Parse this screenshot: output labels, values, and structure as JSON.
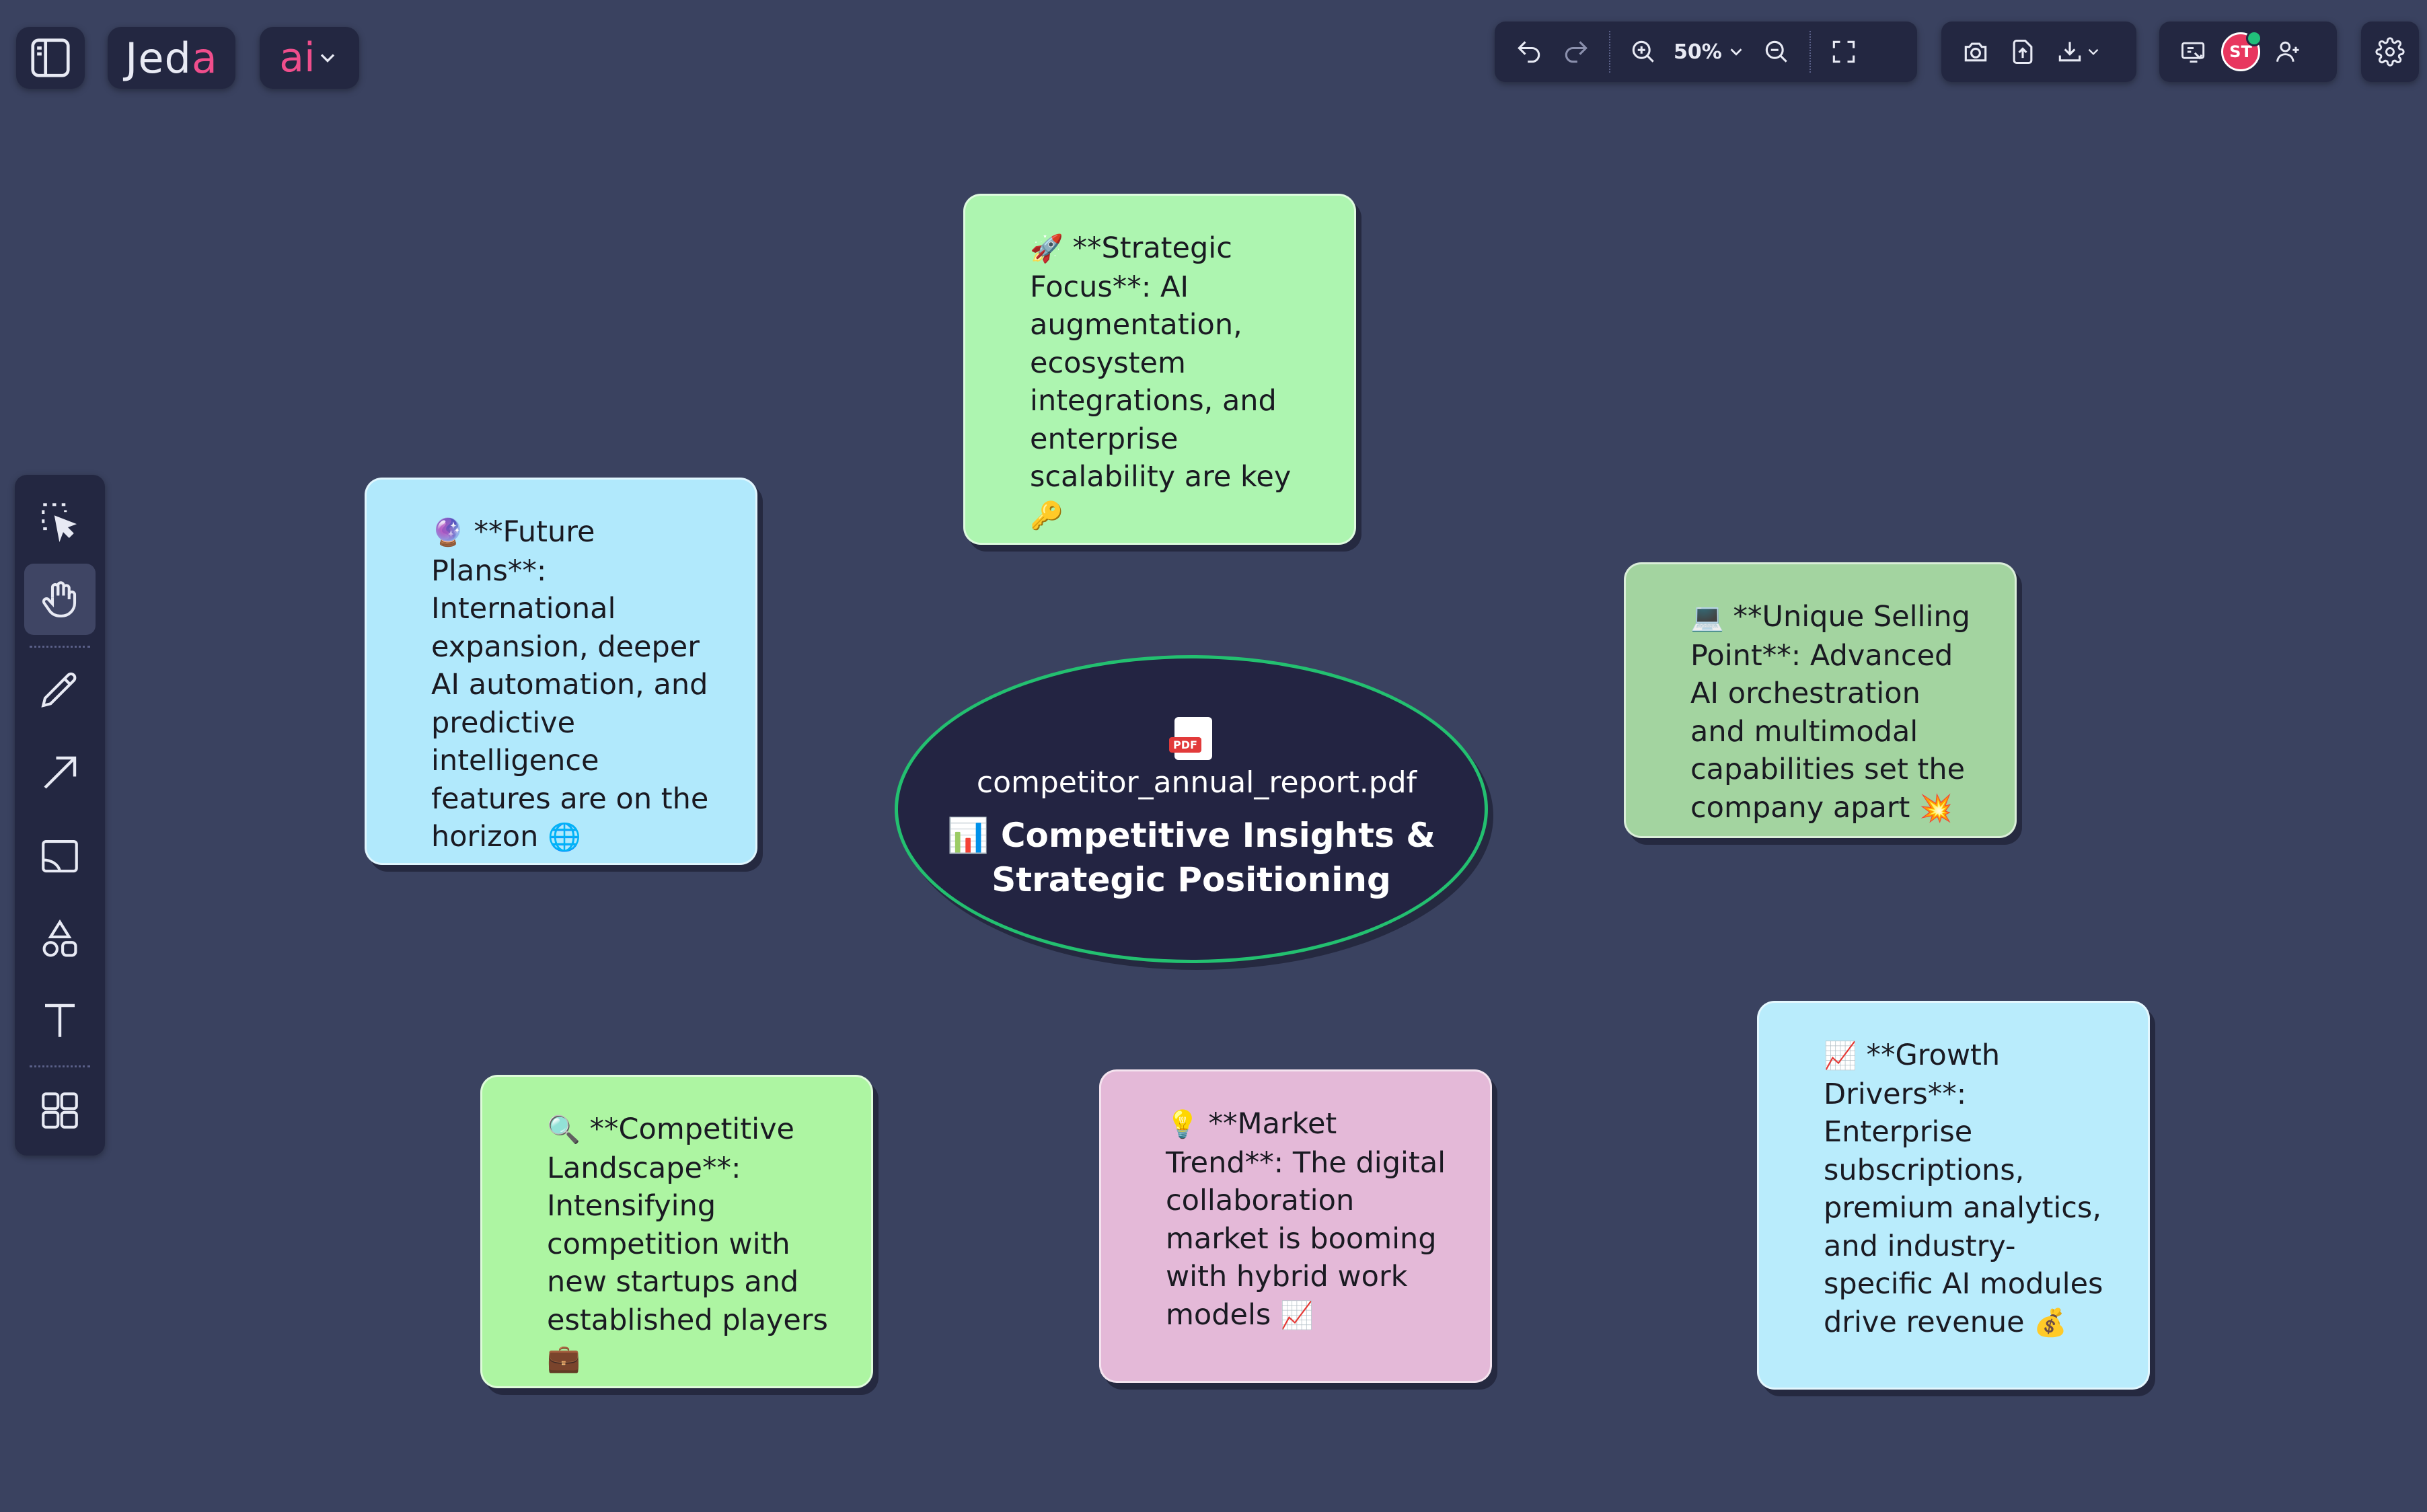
{
  "brand": {
    "logo_main": "Jed",
    "logo_accent": "a",
    "ai_label": "ai"
  },
  "toolbar": {
    "zoom": "50%",
    "user_initials": "ST"
  },
  "mindmap": {
    "center": {
      "file": "competitor_annual_report.pdf",
      "pdf_badge": "PDF",
      "title_emoji": "📊",
      "title_line1": "Competitive Insights &",
      "title_line2": "Strategic Positioning"
    },
    "cards": [
      {
        "emoji_start": "🚀",
        "text": " **Strategic Focus**: AI augmentation, ecosystem integrations, and enterprise scalability are key ",
        "emoji_end": "🔑",
        "color": "#adf5b0"
      },
      {
        "emoji_start": "🔮",
        "text": " **Future Plans**: International expansion, deeper AI automation, and predictive intelligence features are on the horizon ",
        "emoji_end": "🌐",
        "color": "#b1e9fc"
      },
      {
        "emoji_start": "💻",
        "text": " **Unique Selling Point**: Advanced AI orchestration and multimodal capabilities set the company apart ",
        "emoji_end": "💥",
        "color": "#a3d4a0"
      },
      {
        "emoji_start": "🔍",
        "text": " **Competitive Landscape**: Intensifying competition with new startups and established players ",
        "emoji_end": "💼",
        "color": "#adf5a2"
      },
      {
        "emoji_start": "💡",
        "text": " **Market Trend**: The digital collaboration market is booming with hybrid work models ",
        "emoji_end": "📈",
        "color": "#e4b9d8"
      },
      {
        "emoji_start": "📈",
        "text": " **Growth Drivers**: Enterprise subscriptions, premium analytics, and industry-specific AI modules drive revenue ",
        "emoji_end": "💰",
        "color": "#b9ecfc"
      }
    ]
  },
  "colors": {
    "canvas": "#3a4260",
    "panel": "#232741",
    "accent_pink": "#f04e8c",
    "center_border": "#23c070"
  }
}
